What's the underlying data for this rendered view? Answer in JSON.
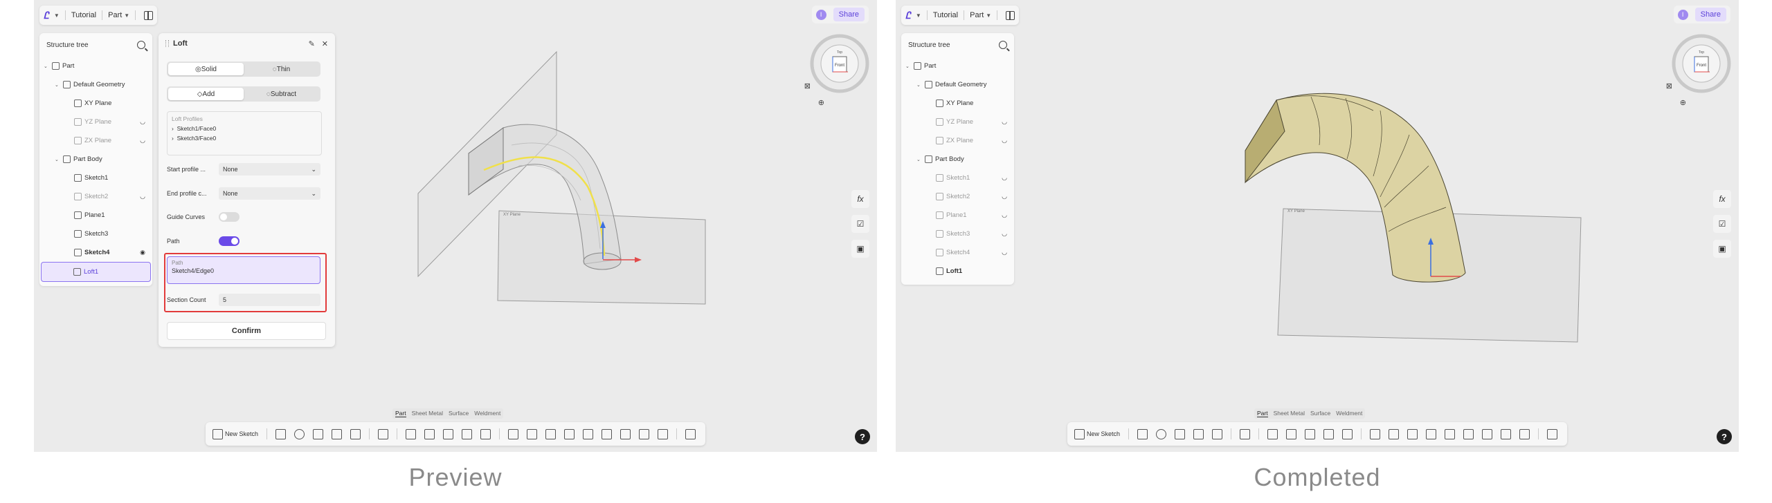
{
  "captions": {
    "left": "Preview",
    "right": "Completed"
  },
  "topbar": {
    "doc": "Tutorial",
    "mode": "Part"
  },
  "share": "Share",
  "user_initial": "I",
  "tree": {
    "title": "Structure tree",
    "part": "Part",
    "default_geometry": "Default Geometry",
    "xy": "XY Plane",
    "yz": "YZ Plane",
    "zx": "ZX Plane",
    "part_body": "Part Body",
    "sketch1": "Sketch1",
    "sketch2": "Sketch2",
    "plane1": "Plane1",
    "sketch3": "Sketch3",
    "sketch4": "Sketch4",
    "loft1": "Loft1"
  },
  "loft": {
    "title": "Loft",
    "solid": "Solid",
    "thin": "Thin",
    "add": "Add",
    "subtract": "Subtract",
    "profiles_title": "Loft Profiles",
    "profile1": "Sketch1/Face0",
    "profile2": "Sketch3/Face0",
    "start_label": "Start profile ...",
    "start_value": "None",
    "end_label": "End profile c...",
    "end_value": "None",
    "guide_label": "Guide Curves",
    "path_label": "Path",
    "path_field_label": "Path",
    "path_field_value": "Sketch4/Edge0",
    "section_label": "Section Count",
    "section_value": "5",
    "confirm": "Confirm"
  },
  "plane_label_left": "XY Plane",
  "plane_label_right": "XY Plane",
  "viewcube": {
    "front": "Front",
    "top": "Top"
  },
  "side": {
    "fx": "fx"
  },
  "bottom_tabs": [
    "Part",
    "Sheet Metal",
    "Surface",
    "Weldment"
  ],
  "toolbar": {
    "new_sketch": "New Sketch"
  },
  "help": "?",
  "colors": {
    "accent": "#5a3fd9",
    "highlight": "#e23b3b",
    "solid": "#d9d2a6"
  }
}
